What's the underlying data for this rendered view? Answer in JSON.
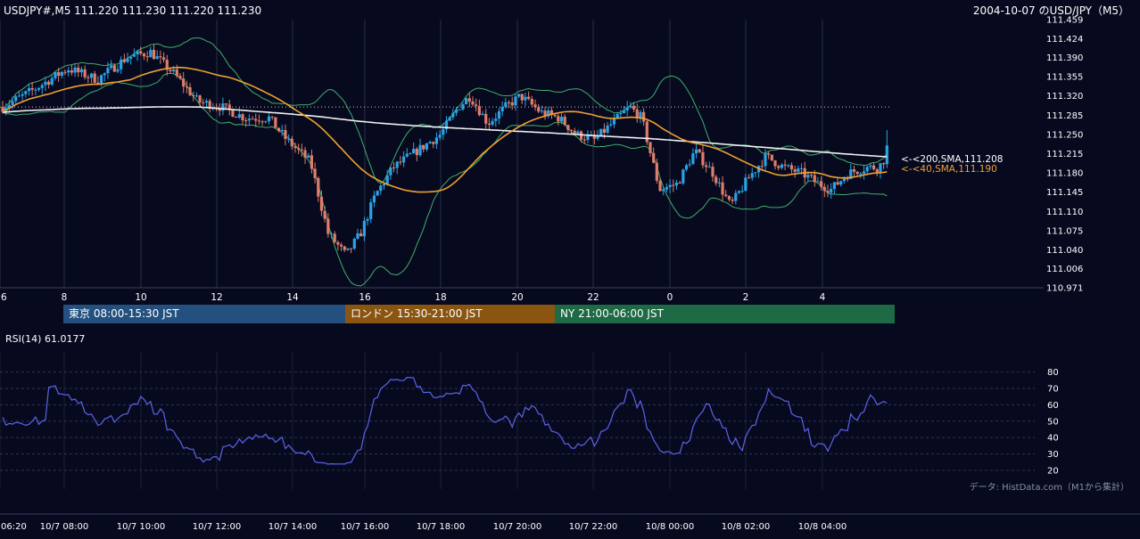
{
  "header": {
    "symbol_info": "USDJPY#,M5 111.220 111.230 111.220 111.230",
    "title": "2004-10-07 のUSD/JPY（M5）"
  },
  "sessions": [
    {
      "label": "東京 08:00-15:30 JST",
      "color": "#23507f"
    },
    {
      "label": "ロンドン 15:30-21:00 JST",
      "color": "#8a5511"
    },
    {
      "label": "NY 21:00-06:00 JST",
      "color": "#1e6a44"
    }
  ],
  "rsi": {
    "label": "RSI(14) 61.0177",
    "color": "#5b63e8"
  },
  "source_note": "データ: HistData.com（M1から集計）",
  "colors": {
    "background": "#070a1f",
    "up_candle": "#2aa3e6",
    "down_candle": "#e07d6a",
    "sma200": "#f0f0f0",
    "sma40": "#f0a030",
    "bollinger": "#3fae6a"
  },
  "chart_data": [
    {
      "type": "candlestick",
      "title": "USDJPY#,M5",
      "ylim": [
        110.971,
        111.459
      ],
      "y_ticks": [
        "111.459",
        "111.424",
        "111.390",
        "111.355",
        "111.320",
        "111.285",
        "111.250",
        "111.215",
        "111.180",
        "111.145",
        "111.110",
        "111.075",
        "111.040",
        "111.006",
        "110.971"
      ],
      "x_ticks": [
        "6",
        "8",
        "10",
        "12",
        "14",
        "16",
        "18",
        "20",
        "22",
        "0",
        "2",
        "4"
      ],
      "reference_line": 111.3,
      "series": [
        {
          "name": "<-<200,SMA,111.208",
          "last": 111.208
        },
        {
          "name": "<-<40,SMA,111.190",
          "last": 111.19
        },
        {
          "name": "Bollinger Bands"
        }
      ],
      "candle_count": 270,
      "price_path": [
        [
          0,
          111.3
        ],
        [
          10,
          111.33
        ],
        [
          22,
          111.37
        ],
        [
          32,
          111.35
        ],
        [
          42,
          111.39
        ],
        [
          50,
          111.4
        ],
        [
          58,
          111.36
        ],
        [
          66,
          111.31
        ],
        [
          74,
          111.3
        ],
        [
          82,
          111.28
        ],
        [
          90,
          111.28
        ],
        [
          96,
          111.24
        ],
        [
          104,
          111.2
        ],
        [
          110,
          111.07
        ],
        [
          116,
          111.03
        ],
        [
          121,
          111.07
        ],
        [
          126,
          111.14
        ],
        [
          132,
          111.19
        ],
        [
          140,
          111.22
        ],
        [
          148,
          111.25
        ],
        [
          154,
          111.3
        ],
        [
          158,
          111.32
        ],
        [
          164,
          111.27
        ],
        [
          170,
          111.3
        ],
        [
          175,
          111.32
        ],
        [
          182,
          111.29
        ],
        [
          188,
          111.28
        ],
        [
          194,
          111.25
        ],
        [
          200,
          111.24
        ],
        [
          206,
          111.27
        ],
        [
          212,
          111.3
        ],
        [
          216,
          111.28
        ],
        [
          222,
          111.15
        ],
        [
          228,
          111.16
        ],
        [
          234,
          111.22
        ],
        [
          240,
          111.18
        ],
        [
          246,
          111.12
        ],
        [
          252,
          111.17
        ],
        [
          258,
          111.21
        ],
        [
          264,
          111.19
        ],
        [
          270,
          111.18
        ],
        [
          276,
          111.16
        ],
        [
          280,
          111.15
        ],
        [
          286,
          111.18
        ],
        [
          292,
          111.19
        ],
        [
          296,
          111.19
        ],
        [
          300,
          111.22
        ]
      ]
    },
    {
      "type": "line",
      "title": "RSI(14) 61.0177",
      "ylim": [
        15,
        88
      ],
      "y_ticks": [
        80,
        70,
        60,
        50,
        40,
        30,
        20
      ],
      "x_ticks": [
        "06:20",
        "10/7 08:00",
        "10/7 10:00",
        "10/7 12:00",
        "10/7 14:00",
        "10/7 16:00",
        "10/7 18:00",
        "10/7 20:00",
        "10/7 22:00",
        "10/8 00:00",
        "10/8 02:00",
        "10/8 04:00"
      ],
      "last_value": 61.0177
    }
  ]
}
